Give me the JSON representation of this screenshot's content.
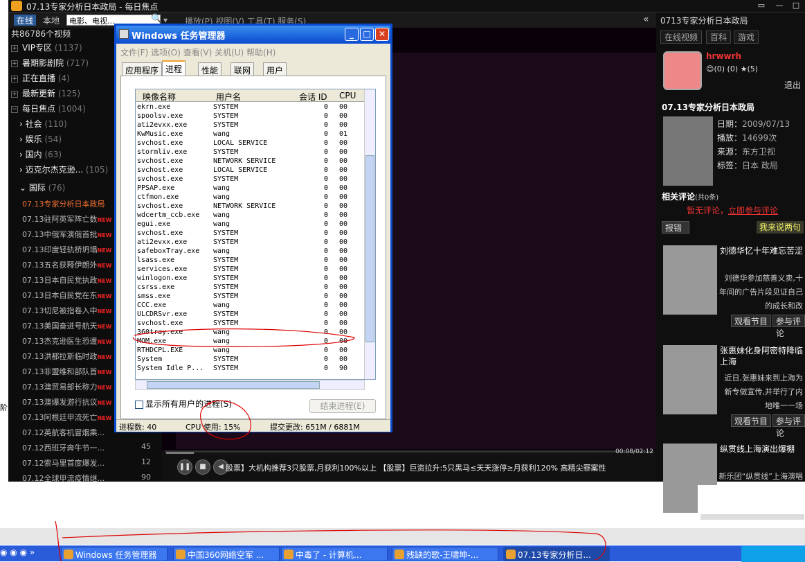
{
  "player": {
    "title": "07.13专家分析日本政局 - 每日焦点",
    "tabs": [
      "在线",
      "本地"
    ],
    "search_value": "电影、电视...",
    "menus": "播放(P)  视图(V)  工具(T)  服务(S)",
    "collapse": "«",
    "total": "共86786个视频",
    "categories": [
      {
        "sign": "+",
        "name": "VIP专区",
        "count": "(1137)"
      },
      {
        "sign": "+",
        "name": "暑期影剧院",
        "count": "(717)"
      },
      {
        "sign": "+",
        "name": "正在直播",
        "count": "(4)"
      },
      {
        "sign": "+",
        "name": "最新更新",
        "count": "(125)"
      },
      {
        "sign": "−",
        "name": "每日焦点",
        "count": "(1004)"
      }
    ],
    "subcategories": [
      {
        "name": "社会",
        "count": "(110)"
      },
      {
        "name": "娱乐",
        "count": "(54)"
      },
      {
        "name": "国内",
        "count": "(63)"
      },
      {
        "name": "迈克尔杰克逊...",
        "count": "(105)"
      }
    ],
    "intl": {
      "name": "国际",
      "count": "(76)"
    },
    "videos": [
      {
        "t": "07.13专家分析日本政局",
        "n": ""
      },
      {
        "t": "07.13驻阿英军阵亡数",
        "n": "NEW"
      },
      {
        "t": "07.13中俄军演俄首批",
        "n": "NEW"
      },
      {
        "t": "07.13印度轻轨桥坍塌",
        "n": "NEW"
      },
      {
        "t": "07.13五名获释伊朗外",
        "n": "NEW"
      },
      {
        "t": "07.13日本自民党执政",
        "n": "NEW"
      },
      {
        "t": "07.13日本自民党在东",
        "n": "NEW"
      },
      {
        "t": "07.13切尼被指卷入中",
        "n": "NEW"
      },
      {
        "t": "07.13美国奋进号航天",
        "n": "NEW"
      },
      {
        "t": "07.13杰克逊医生恐遭",
        "n": "NEW"
      },
      {
        "t": "07.13洪都拉斯临时政",
        "n": "NEW"
      },
      {
        "t": "07.13非盟维和部队首",
        "n": "NEW"
      },
      {
        "t": "07.13澳贸易部长称力",
        "n": "NEW"
      },
      {
        "t": "07.13澳爆发游行抗议",
        "n": "NEW"
      },
      {
        "t": "07.13阿根廷甲流死亡",
        "n": "NEW"
      },
      {
        "t": "07.12英航客机冒烟乘...",
        "n": ""
      },
      {
        "t": "07.12西班牙奔牛节一...",
        "n": "45"
      },
      {
        "t": "07.12索马里首度爆发...",
        "n": "12"
      },
      {
        "t": "07.12全球甲流疫情继...",
        "n": "90"
      }
    ],
    "ticker": "股票】大机构推荐3只股票,月获利100%以上   【股票】巨资拉升:5只黑马≤天天涨停≥月获利120%   高精尖罪案性",
    "timecode": "00:08/02:12",
    "side_char": "阶"
  },
  "right_panel": {
    "header": "0713专家分析日本政局",
    "tabs": [
      "在线视频",
      "百科",
      "游戏"
    ],
    "username": "hrwwrh",
    "stats": "😊(0)  (0)  ★(5)",
    "logout": "退出",
    "video_title": "07.13专家分析日本政局",
    "meta": [
      {
        "k": "日期：",
        "v": "2009/07/13"
      },
      {
        "k": "播放：",
        "v": "14699次"
      },
      {
        "k": "来源：",
        "v": "东方卫视"
      },
      {
        "k": "标签：",
        "v": "日本 政局"
      }
    ],
    "related": "相关评论",
    "related_count": "(共0条)",
    "no_comment": "暂无评论，",
    "comment_link": "立即参与评论",
    "report": "报错",
    "say": "我来说两句",
    "recs": [
      {
        "title": "刘德华忆十年难忘苦涩",
        "desc": "刘德华参加慈善义卖,十年间的广告片段见证自己的成长和改"
      },
      {
        "title": "张惠妹化身阿密特降临上海",
        "desc": "近日,张惠妹来到上海为新专做宣传,并举行了内地唯一一场"
      },
      {
        "title": "纵贯线上海演出爆棚",
        "desc": "新乐团“纵贯线”上海演唱会火爆开"
      }
    ],
    "watch_btn": "观看节目",
    "join_btn": "参与评论"
  },
  "taskmgr": {
    "title": "Windows 任务管理器",
    "menu": "文件(F)  选项(O)  查看(V)  关机(U)  帮助(H)",
    "tabs": [
      "应用程序",
      "进程",
      "性能",
      "联网",
      "用户"
    ],
    "cols": [
      "映像名称",
      "用户名",
      "会话 ID",
      "CPU"
    ],
    "processes": [
      [
        "ekrn.exe",
        "SYSTEM",
        "0",
        "00"
      ],
      [
        "spoolsv.exe",
        "SYSTEM",
        "0",
        "00"
      ],
      [
        "ati2evxx.exe",
        "SYSTEM",
        "0",
        "00"
      ],
      [
        "KwMusic.exe",
        "wang",
        "0",
        "01"
      ],
      [
        "svchost.exe",
        "LOCAL SERVICE",
        "0",
        "00"
      ],
      [
        "stormliv.exe",
        "SYSTEM",
        "0",
        "00"
      ],
      [
        "svchost.exe",
        "NETWORK SERVICE",
        "0",
        "00"
      ],
      [
        "svchost.exe",
        "LOCAL SERVICE",
        "0",
        "00"
      ],
      [
        "svchost.exe",
        "SYSTEM",
        "0",
        "00"
      ],
      [
        "PPSAP.exe",
        "wang",
        "0",
        "00"
      ],
      [
        "ctfmon.exe",
        "wang",
        "0",
        "00"
      ],
      [
        "svchost.exe",
        "NETWORK SERVICE",
        "0",
        "00"
      ],
      [
        "wdcertm_ccb.exe",
        "wang",
        "0",
        "00"
      ],
      [
        "egui.exe",
        "wang",
        "0",
        "00"
      ],
      [
        "svchost.exe",
        "SYSTEM",
        "0",
        "00"
      ],
      [
        "ati2evxx.exe",
        "SYSTEM",
        "0",
        "00"
      ],
      [
        "safeboxTray.exe",
        "wang",
        "0",
        "00"
      ],
      [
        "lsass.exe",
        "SYSTEM",
        "0",
        "00"
      ],
      [
        "services.exe",
        "SYSTEM",
        "0",
        "00"
      ],
      [
        "winlogon.exe",
        "SYSTEM",
        "0",
        "00"
      ],
      [
        "csrss.exe",
        "SYSTEM",
        "0",
        "00"
      ],
      [
        "smss.exe",
        "SYSTEM",
        "0",
        "00"
      ],
      [
        "CCC.exe",
        "wang",
        "0",
        "00"
      ],
      [
        "ULCDRSvr.exe",
        "SYSTEM",
        "0",
        "00"
      ],
      [
        "svchost.exe",
        "SYSTEM",
        "0",
        "00"
      ],
      [
        "360tray.exe",
        "wang",
        "0",
        "00"
      ],
      [
        "MOM.exe",
        "wang",
        "0",
        "00"
      ],
      [
        "RTHDCPL.EXE",
        "wang",
        "0",
        "00"
      ],
      [
        "System",
        "SYSTEM",
        "0",
        "00"
      ],
      [
        "System Idle P...",
        "SYSTEM",
        "0",
        "90"
      ]
    ],
    "show_all": "显示所有用户的进程(S)",
    "end_process": "结束进程(E)",
    "status_procs": "进程数: 40",
    "status_cpu": "CPU 使用: 15%",
    "status_commit": "提交更改: 651M / 6881M"
  },
  "taskbar": {
    "items": [
      {
        "label": "Windows 任务管理器",
        "active": false
      },
      {
        "label": "中国360网络空军 ...",
        "active": false
      },
      {
        "label": "中毒了 - 计算机...",
        "active": false
      },
      {
        "label": "残缺的歌-王啸坤-...",
        "active": false
      },
      {
        "label": "07.13专家分析日...",
        "active": true
      }
    ],
    "clock": ""
  },
  "colors": {
    "xp_blue": "#2a5bd8",
    "annotation": "#d00000",
    "new_badge": "#e22"
  }
}
